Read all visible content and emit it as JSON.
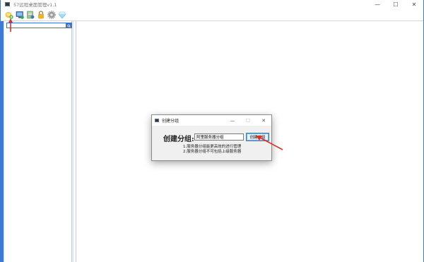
{
  "app": {
    "title": "57远程桌面管理v1.1",
    "window_controls": {
      "minimize": "—",
      "maximize": "☐",
      "close": "✕"
    }
  },
  "toolbar": {
    "buttons": [
      {
        "icon": "add-group-icon"
      },
      {
        "icon": "add-server-icon"
      },
      {
        "icon": "import-icon"
      },
      {
        "icon": "lock-icon"
      },
      {
        "icon": "settings-icon"
      },
      {
        "icon": "diamond-icon"
      }
    ]
  },
  "sidebar": {
    "search": {
      "value": "",
      "placeholder": ""
    }
  },
  "dialog": {
    "title": "创建分组",
    "controls": {
      "minimize": "—",
      "maximize": "☐",
      "close": "✕"
    },
    "label": "创建分组:",
    "input_value": "阿里服务器分组",
    "create_button": "创建分组",
    "notes": [
      "1.服务器分组能更高效的进行管理",
      "2.服务器分组不可包括上级服务器"
    ]
  },
  "colors": {
    "accent": "#3a7bd5",
    "arrow": "#d9302a"
  }
}
